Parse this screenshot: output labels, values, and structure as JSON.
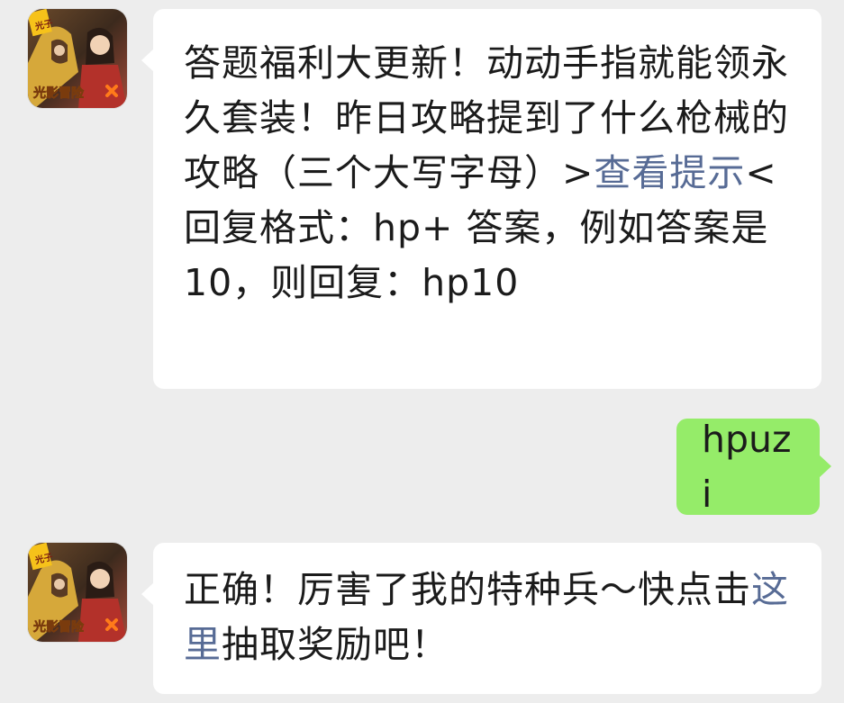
{
  "messages": [
    {
      "sender": "official-account",
      "avatar": {
        "name": "game-avatar-icon",
        "badge_text": "光子",
        "logo_text": "光影冒险"
      },
      "line1": "答题福利大更新！动动手指就能领永久套装！昨日攻略提到了什么枪械的攻略（三个大写字母）>",
      "link": "查看提示",
      "line1_tail": "<",
      "line2": "回复格式：hp+ 答案，例如答案是10，则回复：hp10"
    },
    {
      "sender": "user",
      "text": "hpuzi"
    },
    {
      "sender": "official-account",
      "avatar": {
        "name": "game-avatar-icon",
        "badge_text": "光子",
        "logo_text": "光影冒险"
      },
      "text_before_link": "正确！厉害了我的特种兵～快点击",
      "link": "这里",
      "text_after_link": "抽取奖励吧！"
    }
  ],
  "colors": {
    "background": "#ededed",
    "incoming_bubble": "#ffffff",
    "outgoing_bubble": "#95ec69",
    "link": "#576b95"
  }
}
